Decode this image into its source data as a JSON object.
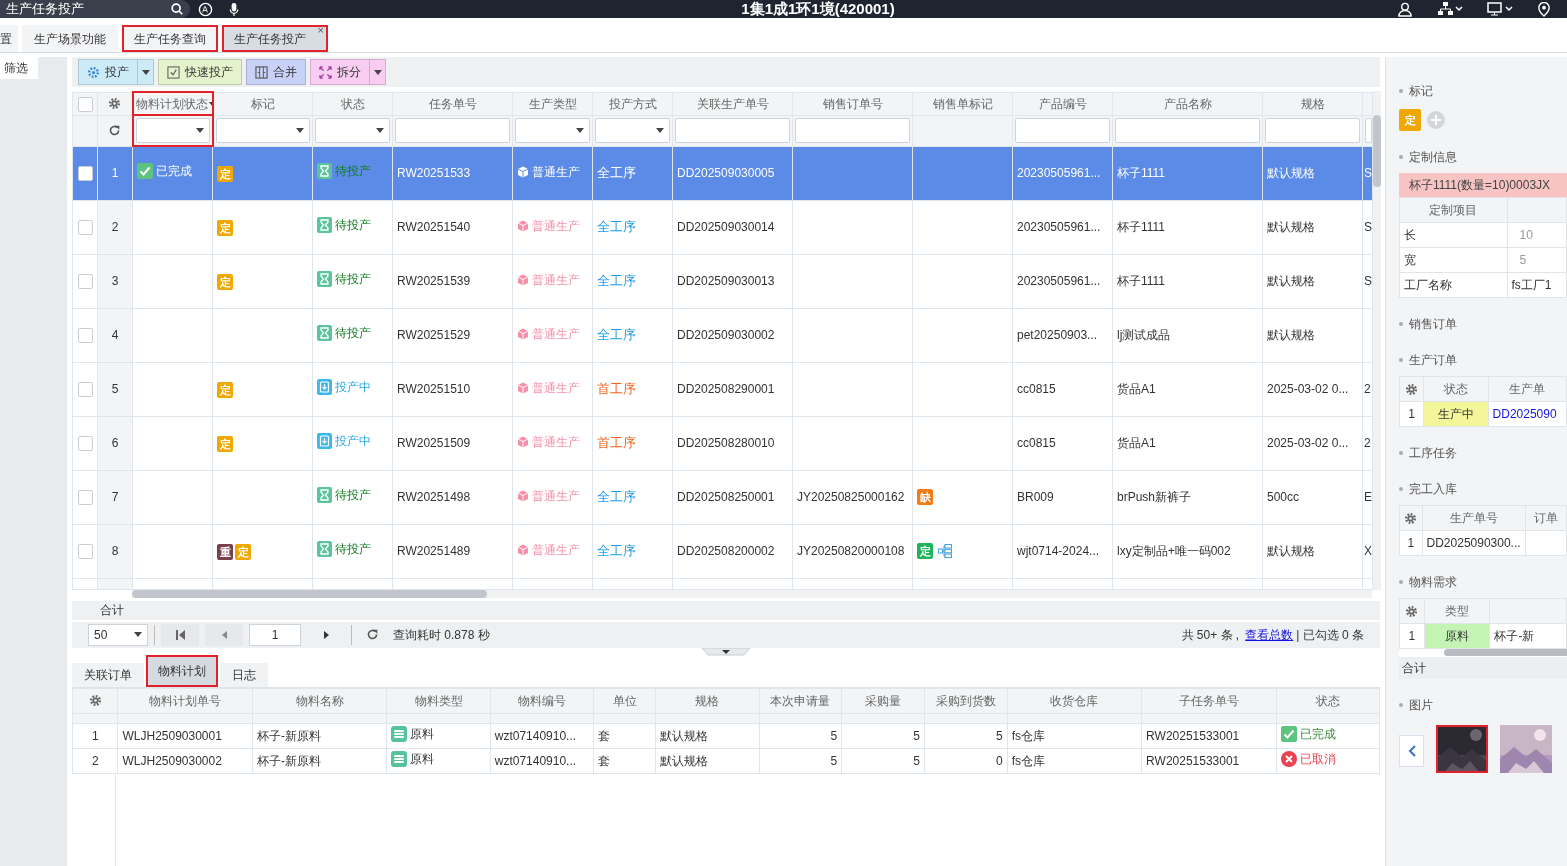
{
  "top_bar": {
    "search": {
      "value": "生产任务投产"
    },
    "title": "1集1成1环1境(420001)"
  },
  "page_tabs": [
    {
      "label": "置",
      "selected": false,
      "highlighted": false
    },
    {
      "label": "生产场景功能",
      "selected": false,
      "highlighted": false
    },
    {
      "label": "生产任务查询",
      "selected": false,
      "highlighted": true
    },
    {
      "label": "生产任务投产",
      "selected": true,
      "highlighted": true,
      "close": "×"
    }
  ],
  "sidebar": {
    "filter_label": "筛选"
  },
  "toolbar": [
    {
      "label": "投产",
      "color": "#cdeaf7",
      "dropdown": true
    },
    {
      "label": "快速投产",
      "color": "#e4f3cb",
      "dropdown": false
    },
    {
      "label": "合并",
      "color": "#c8d1f6",
      "dropdown": false
    },
    {
      "label": "拆分",
      "color": "#f8cdf1",
      "dropdown": true
    }
  ],
  "main_table": {
    "select_all": {
      "checked": false
    },
    "columns": [
      {
        "label": "物料计划状态",
        "highlighted": true,
        "menu": true
      },
      {
        "label": "标记",
        "highlighted": false
      },
      {
        "label": "状态",
        "highlighted": false
      },
      {
        "label": "任务单号",
        "highlighted": false
      },
      {
        "label": "生产类型",
        "highlighted": false
      },
      {
        "label": "投产方式",
        "highlighted": false
      },
      {
        "label": "关联生产单号",
        "highlighted": false
      },
      {
        "label": "销售订单号",
        "highlighted": false
      },
      {
        "label": "销售单标记",
        "highlighted": false
      },
      {
        "label": "产品编号",
        "highlighted": false
      },
      {
        "label": "产品名称",
        "highlighted": false
      },
      {
        "label": "规格",
        "highlighted": false
      }
    ],
    "filters": [
      {
        "kind": "select",
        "highlighted": true
      },
      {
        "kind": "select",
        "highlighted": false
      },
      {
        "kind": "select",
        "highlighted": false
      },
      {
        "kind": "input",
        "highlighted": false
      },
      {
        "kind": "select",
        "highlighted": false
      },
      {
        "kind": "select",
        "highlighted": false
      },
      {
        "kind": "input",
        "highlighted": false
      },
      {
        "kind": "input",
        "highlighted": false
      },
      {
        "kind": "none",
        "highlighted": false
      },
      {
        "kind": "input",
        "highlighted": false
      },
      {
        "kind": "input",
        "highlighted": false
      },
      {
        "kind": "input",
        "highlighted": false
      },
      {
        "kind": "input",
        "highlighted": false
      }
    ],
    "rows": [
      {
        "index": "1",
        "selected": true,
        "checked": false,
        "plan_status": {
          "text": "已完成",
          "kind": "done"
        },
        "marks": [
          {
            "text": "定",
            "color": "#f0a800"
          }
        ],
        "status": {
          "text": "待投产",
          "kind": "pending"
        },
        "task_no": "RW20251533",
        "production_type": "普通生产",
        "mode": {
          "text": "全工序"
        },
        "related_no": "DD202509030005",
        "product_no": "20230505961...",
        "product_name": "杯子1111",
        "spec": "默认规格",
        "column_14": "S"
      },
      {
        "index": "2",
        "selected": false,
        "checked": false,
        "marks": [
          {
            "text": "定",
            "color": "#f0a800"
          }
        ],
        "status": {
          "text": "待投产",
          "kind": "pending"
        },
        "task_no": "RW20251540",
        "production_type": "普通生产",
        "mode": {
          "text": "全工序",
          "color": "#1e9be8"
        },
        "related_no": "DD202509030014",
        "product_no": "20230505961...",
        "product_name": "杯子1111",
        "spec": "默认规格",
        "column_14": "S"
      },
      {
        "index": "3",
        "selected": false,
        "checked": false,
        "marks": [
          {
            "text": "定",
            "color": "#f0a800"
          }
        ],
        "status": {
          "text": "待投产",
          "kind": "pending"
        },
        "task_no": "RW20251539",
        "production_type": "普通生产",
        "mode": {
          "text": "全工序",
          "color": "#1e9be8"
        },
        "related_no": "DD202509030013",
        "product_no": "20230505961...",
        "product_name": "杯子1111",
        "spec": "默认规格",
        "column_14": "S"
      },
      {
        "index": "4",
        "selected": false,
        "checked": false,
        "status": {
          "text": "待投产",
          "kind": "pending"
        },
        "task_no": "RW20251529",
        "production_type": "普通生产",
        "mode": {
          "text": "全工序",
          "color": "#1e9be8"
        },
        "related_no": "DD202509030002",
        "product_no": "pet20250903...",
        "product_name": "lj测试成品",
        "spec": "默认规格"
      },
      {
        "index": "5",
        "selected": false,
        "checked": false,
        "marks": [
          {
            "text": "定",
            "color": "#f0a800"
          }
        ],
        "status": {
          "text": "投产中",
          "kind": "in_progress"
        },
        "task_no": "RW20251510",
        "production_type": "普通生产",
        "mode": {
          "text": "首工序",
          "color": "#f2661f"
        },
        "related_no": "DD202508290001",
        "product_no": "cc0815",
        "product_name": "货品A1",
        "spec": "2025-03-02 0...",
        "column_14": "2"
      },
      {
        "index": "6",
        "selected": false,
        "checked": false,
        "marks": [
          {
            "text": "定",
            "color": "#f0a800"
          }
        ],
        "status": {
          "text": "投产中",
          "kind": "in_progress"
        },
        "task_no": "RW20251509",
        "production_type": "普通生产",
        "mode": {
          "text": "首工序",
          "color": "#f2661f"
        },
        "related_no": "DD202508280010",
        "product_no": "cc0815",
        "product_name": "货品A1",
        "spec": "2025-03-02 0...",
        "column_14": "2"
      },
      {
        "index": "7",
        "selected": false,
        "checked": false,
        "status": {
          "text": "待投产",
          "kind": "pending"
        },
        "task_no": "RW20251498",
        "production_type": "普通生产",
        "mode": {
          "text": "全工序",
          "color": "#1e9be8"
        },
        "related_no": "DD202508250001",
        "sales_no": "JY20250825000162",
        "sales_marks": [
          {
            "kind": "tag",
            "text": "缺",
            "color": "#f57c14"
          }
        ],
        "product_no": "BR009",
        "product_name": "brPush新裤子",
        "spec": "500cc",
        "column_14": "E"
      },
      {
        "index": "8",
        "selected": false,
        "checked": false,
        "marks": [
          {
            "text": "重",
            "color": "#7a3f4a"
          },
          {
            "text": "定",
            "color": "#f0a800"
          }
        ],
        "status": {
          "text": "待投产",
          "kind": "pending"
        },
        "task_no": "RW20251489",
        "production_type": "普通生产",
        "mode": {
          "text": "全工序",
          "color": "#1e9be8"
        },
        "related_no": "DD202508200002",
        "sales_no": "JY20250820000108",
        "sales_marks": [
          {
            "kind": "tag",
            "text": "定",
            "color": "#1fb35a"
          },
          {
            "kind": "tree"
          }
        ],
        "product_no": "wjt0714-2024...",
        "product_name": "lxy定制品+唯一码002",
        "spec": "默认规格",
        "column_14": "X"
      }
    ]
  },
  "footer": {
    "sum_label": "合计",
    "page_size": "50",
    "page": "1",
    "query_time": "查询耗时 0.878 秒",
    "total": "共 50+ 条 ,",
    "total_link": "查看总数",
    "selected_info": "| 已勾选 0 条"
  },
  "bottom_tabs": [
    {
      "label": "关联订单",
      "selected": false,
      "highlighted": false
    },
    {
      "label": "物料计划",
      "selected": true,
      "highlighted": true
    },
    {
      "label": "日志",
      "selected": false,
      "highlighted": false
    }
  ],
  "bottom_table": {
    "columns": [
      "物料计划单号",
      "物料名称",
      "物料类型",
      "物料编号",
      "单位",
      "规格",
      "本次申请量",
      "采购量",
      "采购到货数",
      "收货仓库",
      "子任务单号",
      "状态"
    ],
    "rows": [
      {
        "index": "1",
        "plan_no": "WLJH2509030001",
        "material_name": "杯子-新原料",
        "material_type": "原料",
        "material_no": "wzt07140910...",
        "unit": "套",
        "spec": "默认规格",
        "requested": "5",
        "purchased": "5",
        "arrived": "5",
        "warehouse": "fs仓库",
        "subtask_no": "RW20251533001",
        "status": {
          "text": "已完成",
          "kind": "done"
        }
      },
      {
        "index": "2",
        "plan_no": "WLJH2509030002",
        "material_name": "杯子-新原料",
        "material_type": "原料",
        "material_no": "wzt07140910...",
        "unit": "套",
        "spec": "默认规格",
        "requested": "5",
        "purchased": "5",
        "arrived": "0",
        "warehouse": "fs仓库",
        "subtask_no": "RW20251533001",
        "status": {
          "text": "已取消",
          "kind": "cancelled"
        }
      }
    ]
  },
  "right_panel": {
    "sections": [
      {
        "kind": "marks",
        "title": "标记",
        "tags": [
          {
            "text": "定",
            "color": "#f0a800"
          }
        ]
      },
      {
        "kind": "custom",
        "title": "定制信息",
        "banner": "杯子1111(数量=10)0003JX",
        "header": "定制项目",
        "rows": [
          {
            "name": "长",
            "value": "10",
            "muted": true
          },
          {
            "name": "宽",
            "value": "5",
            "muted": true
          },
          {
            "name": "工厂名称",
            "value": "fs工厂1",
            "muted": false
          }
        ]
      },
      {
        "kind": "empty",
        "title": "销售订单"
      },
      {
        "kind": "grid",
        "title": "生产订单",
        "columns": [
          "状态",
          "生产单"
        ],
        "rows": [
          {
            "index": "1",
            "cells": [
              {
                "text": "生产中",
                "color": "#f3f79a"
              },
              {
                "text": "DD2025090",
                "link": true
              }
            ]
          }
        ]
      },
      {
        "kind": "empty",
        "title": "工序任务"
      },
      {
        "kind": "grid",
        "title": "完工入库",
        "columns": [
          "生产单号",
          "订单"
        ],
        "rows": [
          {
            "index": "1",
            "cells": [
              {
                "text": "DD2025090300..."
              }
            ]
          }
        ]
      },
      {
        "kind": "grid",
        "title": "物料需求",
        "columns": [
          "类型"
        ],
        "rows": [
          {
            "index": "1",
            "cells": [
              {
                "text": "原料",
                "color": "#c4f4b3"
              },
              {
                "text": "杯子-新"
              }
            ]
          }
        ],
        "scrollbar": true,
        "sum_label": "合计"
      },
      {
        "kind": "images",
        "title": "图片",
        "images": [
          {
            "kind": "picture",
            "selected": true
          },
          {
            "kind": "picture",
            "selected": false
          }
        ]
      }
    ]
  }
}
